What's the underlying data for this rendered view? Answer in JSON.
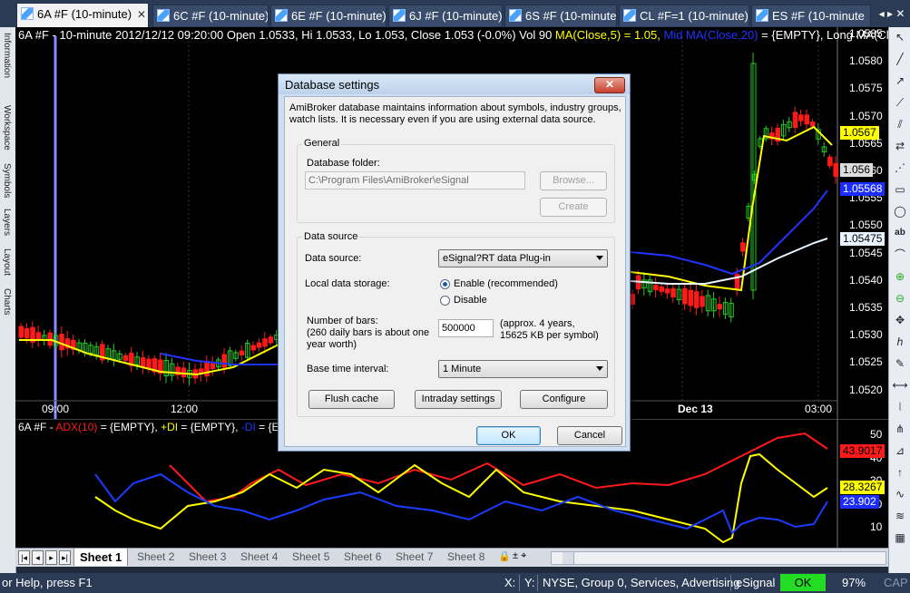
{
  "tabs": [
    {
      "label": "6A #F (10-minute)",
      "active": true
    },
    {
      "label": "6C #F (10-minute)"
    },
    {
      "label": "6E #F (10-minute)"
    },
    {
      "label": "6J #F (10-minute)"
    },
    {
      "label": "6S #F (10-minute)"
    },
    {
      "label": "CL #F=1 (10-minute)"
    },
    {
      "label": "ES #F (10-minute"
    }
  ],
  "tab_close_glyph": "✕",
  "window_buttons": "◂ ▸ ✕",
  "left_strip": [
    "Information",
    "Workspace",
    "Symbols",
    "Layers",
    "Layout",
    "Charts"
  ],
  "price_chart": {
    "header_prefix": "6A #F - 10-minute 2012/12/12 09:20:00 Open 1.0533, Hi 1.0533, Lo 1.053, Close 1.053 (-0.0%) Vol 90 ",
    "header_ma5": "MA(Close,5) = 1.05,",
    "header_mid": "Mid MA(Close,20)",
    "header_suffix": " = {EMPTY}, Long MA(Cl",
    "y_ticks": [
      "1.0585",
      "1.0580",
      "1.0575",
      "1.0570",
      "1.0565",
      "1.0560",
      "1.0555",
      "1.0550",
      "1.0545",
      "1.0540",
      "1.0535",
      "1.0530",
      "1.0525",
      "1.0520"
    ],
    "x_ticks": [
      "09:00",
      "12:00",
      "Dec 13",
      "03:00"
    ],
    "tags": {
      "ma5": "1.0567",
      "last": "1.056",
      "mid": "1.05568",
      "long": "1.05475"
    },
    "colors": {
      "up": "#22cc22",
      "down": "#ff1a1a",
      "ma5": "#ffff00",
      "mid": "#2233ff",
      "long": "#e8f4ff"
    }
  },
  "indicator_chart": {
    "header_prefix": "6A #F - ",
    "header_adx": "ADX(10)",
    "header_mid1": " = {EMPTY}, ",
    "header_pdi": "+DI",
    "header_mid2": " = {EMPTY}, ",
    "header_mdi": "-DI",
    "header_suffix": " = {EM",
    "y_ticks": [
      "50",
      "40",
      "30",
      "20",
      "10"
    ],
    "tags": {
      "adx": "43.9017",
      "pdi": "28.3267",
      "mdi": "23.902"
    },
    "colors": {
      "adx": "#ff1a1a",
      "pdi": "#ffff00",
      "mdi": "#1a3cff"
    }
  },
  "sheets": [
    "Sheet 1",
    "Sheet 2",
    "Sheet 3",
    "Sheet 4",
    "Sheet 5",
    "Sheet 6",
    "Sheet 7",
    "Sheet 8"
  ],
  "status": {
    "help": "or Help, press F1",
    "x": "X:",
    "y": "Y:",
    "info": "NYSE, Group 0, Services, Advertising",
    "source": "eSignal",
    "ok": "OK",
    "zoom": "97%",
    "cap": "CAP"
  },
  "dialog": {
    "title": "Database settings",
    "close": "✕",
    "description_line1": "AmiBroker database maintains information about symbols, industry groups,",
    "description_line2": "watch lists. It is necessary even if you are using external data source.",
    "general_label": "General",
    "folder_label": "Database folder:",
    "folder_value": "C:\\Program Files\\AmiBroker\\eSignal",
    "browse_label": "Browse...",
    "create_label": "Create",
    "datasource_group": "Data source",
    "datasource_label": "Data source:",
    "datasource_value": "eSignal?RT data Plug-in",
    "storage_label": "Local data storage:",
    "enable_label": "Enable (recommended)",
    "disable_label": "Disable",
    "bars_label1": "Number of bars:",
    "bars_label2": "(260 daily bars is about one",
    "bars_label3": "year worth)",
    "bars_value": "500000",
    "bars_note1": "(approx. 4 years,",
    "bars_note2": "15625 KB per symbol)",
    "interval_label": "Base time interval:",
    "interval_value": "1 Minute",
    "flush_label": "Flush cache",
    "intraday_label": "Intraday settings",
    "configure_label": "Configure",
    "ok_label": "OK",
    "cancel_label": "Cancel"
  }
}
